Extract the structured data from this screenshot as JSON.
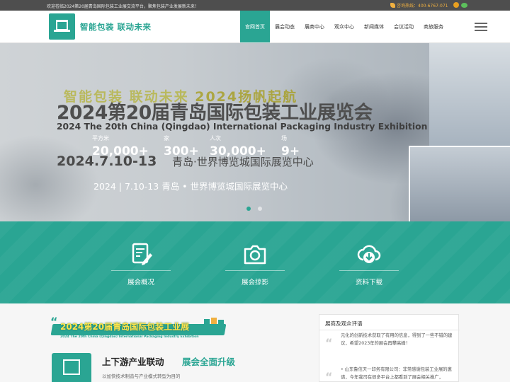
{
  "topbar": {
    "welcome": "欢迎莅临2024第20届青岛国际包装工业展交流平台，聚焦包装产业发展新未来！",
    "hotline_label": "咨询热线：400-6767-071",
    "icons": [
      "phone-icon",
      "weibo-icon",
      "wechat-icon"
    ]
  },
  "header": {
    "logo_icon": "package-cube-icon",
    "slogan": "智能包装  联动未来",
    "nav": [
      {
        "label": "官网首页",
        "active": true
      },
      {
        "label": "展会动态"
      },
      {
        "label": "展商中心"
      },
      {
        "label": "观众中心"
      },
      {
        "label": "新闻媒体"
      },
      {
        "label": "会议活动"
      },
      {
        "label": "商旅服务"
      }
    ]
  },
  "banner": {
    "slogan_a": "智能包装  联动未来  ",
    "slogan_year": "2024扬帆起航",
    "title": "2024第20届青岛国际包装工业展览会",
    "title_en": "2024 The 20th China (Qingdao) International Packaging  Industry Exhibition",
    "stats": [
      {
        "value": "20,000+",
        "unit": "平方米"
      },
      {
        "value": "300+",
        "unit": "家"
      },
      {
        "value": "30,000+",
        "unit": "人次"
      },
      {
        "value": "9+",
        "unit": "场"
      }
    ],
    "date": "2024.7.10-13",
    "venue": "青岛·世界博览城国际展览中心",
    "dateline": "2024 | 7.10-13  青岛 • 世界博览城国际展览中心",
    "slides": 2,
    "active_slide": 1
  },
  "features": [
    {
      "label": "展会概况",
      "icon": "document-edit-icon"
    },
    {
      "label": "展会掠影",
      "icon": "camera-icon"
    },
    {
      "label": "资料下载",
      "icon": "cloud-download-icon"
    }
  ],
  "expo": {
    "badge_title": "2024第20届青岛国际包装工业展",
    "badge_sub": "2024 The 20th China (Qingdao) International Packaging Industry Exhibition",
    "upgrade_title": "上下游产业联动",
    "upgrade_title2": "展会全面升级",
    "upgrade_desc": "以加快技术制造与产业模式转型为目的"
  },
  "review": {
    "title": "展商及观众评语",
    "p1": "元化的创新技术获取了有用的信息，得到了一些不错的建议，希望2023年的展会再攀高峰！",
    "p2": "• 山东鲁信天一印务有限公司：非常感谢包装工业展的邀请，今年我司在很多平台上都看到了展会相关推广，"
  },
  "colors": {
    "accent": "#2aa593",
    "topbar": "#4e4e4e",
    "hotline": "#f0b040"
  }
}
